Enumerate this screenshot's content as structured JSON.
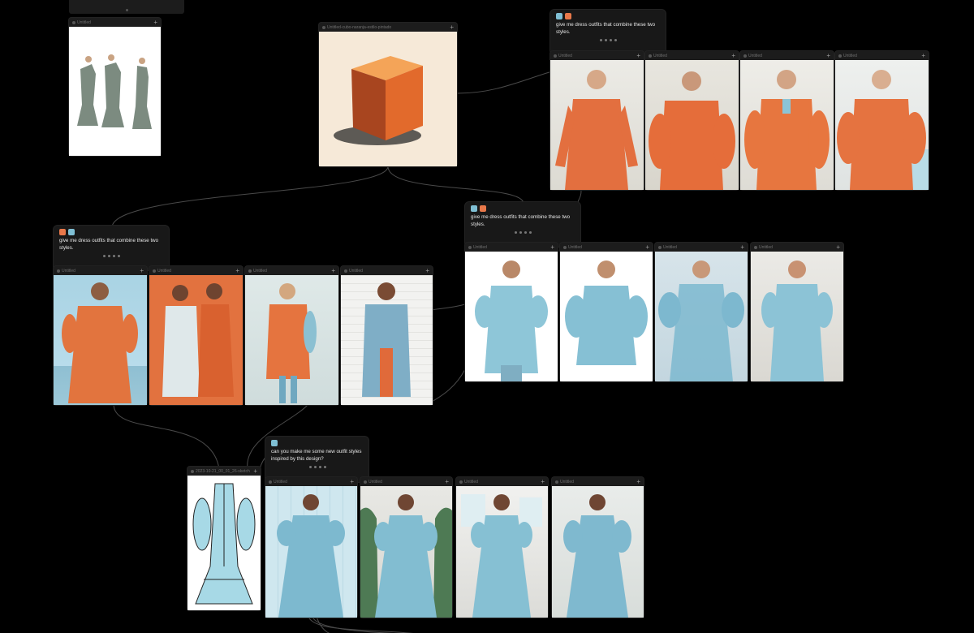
{
  "canvas": {
    "nodes": [
      {
        "id": "n-green",
        "label": "Untitled"
      },
      {
        "id": "n-cube",
        "label": "Untitled-cubo-naranja-estilo-pintado"
      },
      {
        "id": "o1",
        "label": "Untitled"
      },
      {
        "id": "o2",
        "label": "Untitled"
      },
      {
        "id": "o3",
        "label": "Untitled"
      },
      {
        "id": "o4",
        "label": "Untitled"
      },
      {
        "id": "m1",
        "label": "Untitled"
      },
      {
        "id": "m2",
        "label": "Untitled"
      },
      {
        "id": "m3",
        "label": "Untitled"
      },
      {
        "id": "m4",
        "label": "Untitled"
      },
      {
        "id": "b1",
        "label": "Untitled"
      },
      {
        "id": "b2",
        "label": "Untitled"
      },
      {
        "id": "b3",
        "label": "Untitled"
      },
      {
        "id": "b4",
        "label": "Untitled"
      },
      {
        "id": "sketch",
        "label": "2023-10-21_00_01_26-sketch"
      },
      {
        "id": "t1",
        "label": "Untitled"
      },
      {
        "id": "t2",
        "label": "Untitled"
      },
      {
        "id": "t3",
        "label": "Untitled"
      },
      {
        "id": "t4",
        "label": "Untitled"
      }
    ],
    "prompts": [
      {
        "id": "p-top",
        "text": "give me dress outfits that combine these two styles."
      },
      {
        "id": "p-left",
        "text": "give me dress outfits that combine these two styles."
      },
      {
        "id": "p-mid",
        "text": "give me dress outfits that combine these two styles."
      },
      {
        "id": "p-bottom",
        "text": "can you make me some new outfit styles inspired by this design?"
      }
    ],
    "plus_label": "+"
  },
  "colors": {
    "orange": "#e8784a",
    "blue": "#7fbfd4",
    "node_bg": "#1c1c1c",
    "canvas_bg": "#000000"
  }
}
